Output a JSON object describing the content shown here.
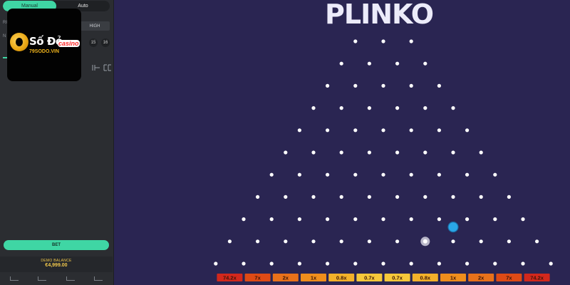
{
  "title": "PLINKO",
  "logo": {
    "brand": "Số Đỏ",
    "sub": "casino",
    "url": "79SODO.VIN"
  },
  "sidebar": {
    "tabs": [
      {
        "label": "Manual",
        "active": true
      },
      {
        "label": "Auto",
        "active": false
      }
    ],
    "risk_label": "RI",
    "risk_options": [
      "HIGH"
    ],
    "rows_label": "N",
    "row_numbers": [
      "15",
      "16"
    ],
    "bet_label": "BET",
    "balance_label": "DEMO BALANCE",
    "balance_value": "€4,999.00"
  },
  "multipliers": [
    {
      "label": "74.2x",
      "color": "#d2281c"
    },
    {
      "label": "7x",
      "color": "#de4a15"
    },
    {
      "label": "2x",
      "color": "#e8711a"
    },
    {
      "label": "1x",
      "color": "#ef8e1c"
    },
    {
      "label": "0.8x",
      "color": "#f3b12a"
    },
    {
      "label": "0.7x",
      "color": "#f6c83a"
    },
    {
      "label": "0.7x",
      "color": "#f6c83a"
    },
    {
      "label": "0.8x",
      "color": "#f3b12a"
    },
    {
      "label": "1x",
      "color": "#ef8e1c"
    },
    {
      "label": "2x",
      "color": "#e8711a"
    },
    {
      "label": "7x",
      "color": "#de4a15"
    },
    {
      "label": "74.2x",
      "color": "#d2281c"
    }
  ],
  "colors": {
    "accent": "#3fd6a4",
    "board_bg": "#2a2552",
    "peg": "#ffffff",
    "ball": "#2aa7e8"
  },
  "pegs": {
    "rows": 11,
    "first_row_count": 3
  },
  "ball": {
    "row": 9,
    "gap": 7.5
  }
}
